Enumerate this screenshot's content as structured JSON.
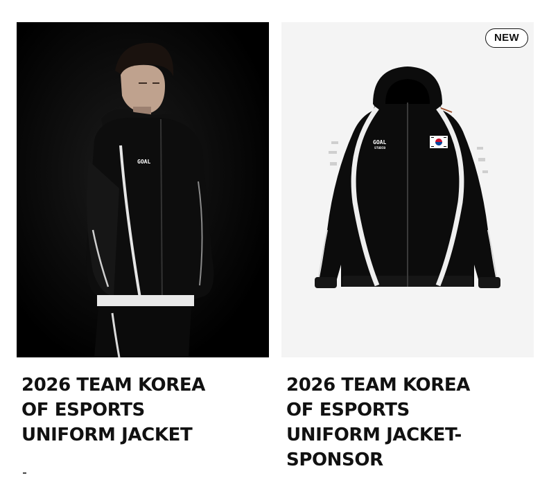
{
  "products": [
    {
      "title": "2026 TEAM KOREA\nOF ESPORTS\nUNIFORM JACKET",
      "image": "model-wearing-black-jacket"
    },
    {
      "title": "2026 TEAM KOREA\nOF ESPORTS\nUNIFORM JACKET-\nSPONSOR",
      "image": "black-jacket-product-shot",
      "badge": "NEW"
    }
  ],
  "jacket_logo": "GOAL",
  "jacket_logo_sub": "STUDIO",
  "colors": {
    "photo_dark_bg": "#000000",
    "photo_light_bg": "#f4f4f4",
    "jacket": "#0c0c0c",
    "piping": "#e8e8e8",
    "text": "#111111"
  }
}
